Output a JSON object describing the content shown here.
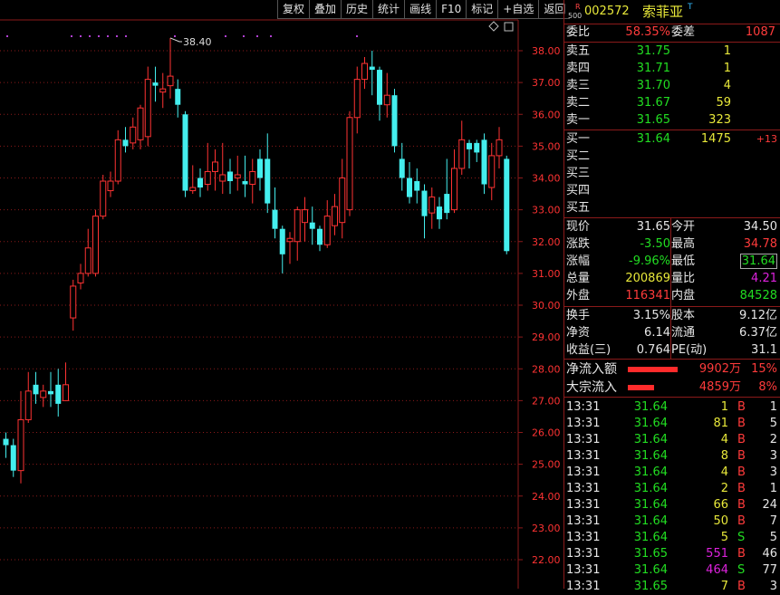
{
  "toolbar": [
    "复权",
    "叠加",
    "历史",
    "统计",
    "画线",
    "F10",
    "标记",
    "+自选",
    "返回"
  ],
  "chart": {
    "price_ticks": [
      "38.00",
      "37.00",
      "36.00",
      "35.00",
      "34.00",
      "33.00",
      "32.00",
      "31.00",
      "30.00",
      "29.00",
      "28.00",
      "27.00",
      "26.00",
      "25.00",
      "24.00",
      "23.00",
      "22.00"
    ],
    "high_label": "38.40",
    "colors": {
      "up": "#ff3333",
      "down": "#44eeee",
      "grid": "#8b1a1a",
      "axis_text": "#ff3333"
    }
  },
  "chart_data": {
    "type": "candlestick",
    "ylim": [
      21.6,
      38.9
    ],
    "candles": [
      {
        "o": 25.8,
        "c": 25.6,
        "h": 26.0,
        "l": 25.2
      },
      {
        "o": 25.6,
        "c": 24.8,
        "h": 25.8,
        "l": 24.6
      },
      {
        "o": 24.8,
        "c": 26.4,
        "h": 27.3,
        "l": 24.4
      },
      {
        "o": 26.4,
        "c": 27.3,
        "h": 27.9,
        "l": 26.3
      },
      {
        "o": 27.5,
        "c": 27.2,
        "h": 27.9,
        "l": 26.9
      },
      {
        "o": 27.1,
        "c": 27.3,
        "h": 27.5,
        "l": 26.8
      },
      {
        "o": 27.3,
        "c": 27.2,
        "h": 27.9,
        "l": 26.8
      },
      {
        "o": 27.5,
        "c": 26.9,
        "h": 28.0,
        "l": 26.5
      },
      {
        "o": 27.0,
        "c": 27.5,
        "h": 28.2,
        "l": 27.0
      },
      {
        "o": 29.6,
        "c": 30.6,
        "h": 30.8,
        "l": 29.2
      },
      {
        "o": 30.7,
        "c": 31.0,
        "h": 31.3,
        "l": 30.5
      },
      {
        "o": 31.0,
        "c": 31.8,
        "h": 32.4,
        "l": 30.9
      },
      {
        "o": 31.0,
        "c": 32.8,
        "h": 33.0,
        "l": 30.9
      },
      {
        "o": 32.8,
        "c": 33.9,
        "h": 34.1,
        "l": 32.7
      },
      {
        "o": 33.6,
        "c": 33.9,
        "h": 34.2,
        "l": 33.4
      },
      {
        "o": 33.9,
        "c": 35.2,
        "h": 35.5,
        "l": 33.8
      },
      {
        "o": 35.2,
        "c": 35.0,
        "h": 35.6,
        "l": 34.8
      },
      {
        "o": 35.1,
        "c": 35.6,
        "h": 35.9,
        "l": 34.9
      },
      {
        "o": 35.2,
        "c": 36.2,
        "h": 36.3,
        "l": 34.9
      },
      {
        "o": 35.3,
        "c": 37.1,
        "h": 37.5,
        "l": 35.0
      },
      {
        "o": 37.0,
        "c": 36.9,
        "h": 37.5,
        "l": 36.4
      },
      {
        "o": 36.7,
        "c": 36.8,
        "h": 37.3,
        "l": 36.2
      },
      {
        "o": 36.9,
        "c": 37.2,
        "h": 38.4,
        "l": 36.5
      },
      {
        "o": 36.8,
        "c": 36.3,
        "h": 37.1,
        "l": 35.9
      },
      {
        "o": 36.0,
        "c": 33.6,
        "h": 36.1,
        "l": 33.4
      },
      {
        "o": 33.6,
        "c": 33.7,
        "h": 34.4,
        "l": 33.5
      },
      {
        "o": 34.0,
        "c": 33.7,
        "h": 34.3,
        "l": 33.4
      },
      {
        "o": 33.8,
        "c": 34.2,
        "h": 35.1,
        "l": 33.6
      },
      {
        "o": 34.2,
        "c": 34.5,
        "h": 34.9,
        "l": 33.6
      },
      {
        "o": 33.9,
        "c": 34.1,
        "h": 35.1,
        "l": 33.5
      },
      {
        "o": 34.2,
        "c": 33.9,
        "h": 34.6,
        "l": 33.5
      },
      {
        "o": 34.0,
        "c": 34.1,
        "h": 34.7,
        "l": 33.6
      },
      {
        "o": 33.9,
        "c": 33.8,
        "h": 34.7,
        "l": 33.4
      },
      {
        "o": 33.8,
        "c": 34.2,
        "h": 34.6,
        "l": 33.2
      },
      {
        "o": 34.6,
        "c": 34.0,
        "h": 34.9,
        "l": 33.6
      },
      {
        "o": 34.6,
        "c": 33.2,
        "h": 35.4,
        "l": 32.9
      },
      {
        "o": 33.0,
        "c": 32.4,
        "h": 33.7,
        "l": 32.1
      },
      {
        "o": 32.4,
        "c": 31.6,
        "h": 32.5,
        "l": 31.0
      },
      {
        "o": 32.0,
        "c": 32.1,
        "h": 32.3,
        "l": 31.3
      },
      {
        "o": 32.0,
        "c": 33.0,
        "h": 33.1,
        "l": 31.4
      },
      {
        "o": 32.6,
        "c": 33.0,
        "h": 33.4,
        "l": 32.0
      },
      {
        "o": 32.6,
        "c": 32.4,
        "h": 33.1,
        "l": 31.9
      },
      {
        "o": 32.4,
        "c": 31.9,
        "h": 32.5,
        "l": 31.7
      },
      {
        "o": 31.9,
        "c": 32.8,
        "h": 33.3,
        "l": 31.8
      },
      {
        "o": 32.5,
        "c": 33.1,
        "h": 33.5,
        "l": 32.2
      },
      {
        "o": 32.6,
        "c": 34.0,
        "h": 34.6,
        "l": 32.1
      },
      {
        "o": 33.0,
        "c": 35.9,
        "h": 36.1,
        "l": 32.8
      },
      {
        "o": 35.9,
        "c": 37.1,
        "h": 37.5,
        "l": 35.4
      },
      {
        "o": 37.1,
        "c": 37.6,
        "h": 37.8,
        "l": 36.8
      },
      {
        "o": 37.5,
        "c": 37.4,
        "h": 38.0,
        "l": 36.6
      },
      {
        "o": 37.4,
        "c": 36.3,
        "h": 37.5,
        "l": 35.8
      },
      {
        "o": 36.3,
        "c": 36.6,
        "h": 37.3,
        "l": 35.9
      },
      {
        "o": 36.6,
        "c": 35.0,
        "h": 36.8,
        "l": 34.8
      },
      {
        "o": 34.6,
        "c": 34.0,
        "h": 35.1,
        "l": 33.6
      },
      {
        "o": 34.0,
        "c": 33.4,
        "h": 34.5,
        "l": 33.2
      },
      {
        "o": 33.9,
        "c": 33.6,
        "h": 34.3,
        "l": 33.2
      },
      {
        "o": 33.6,
        "c": 32.8,
        "h": 33.8,
        "l": 32.1
      },
      {
        "o": 32.9,
        "c": 33.4,
        "h": 33.7,
        "l": 32.4
      },
      {
        "o": 33.1,
        "c": 32.7,
        "h": 33.4,
        "l": 32.4
      },
      {
        "o": 33.5,
        "c": 32.9,
        "h": 34.6,
        "l": 32.7
      },
      {
        "o": 33.0,
        "c": 34.3,
        "h": 34.9,
        "l": 32.9
      },
      {
        "o": 34.3,
        "c": 35.2,
        "h": 35.8,
        "l": 34.1
      },
      {
        "o": 35.1,
        "c": 34.9,
        "h": 35.2,
        "l": 34.3
      },
      {
        "o": 35.1,
        "c": 34.8,
        "h": 35.2,
        "l": 34.5
      },
      {
        "o": 35.2,
        "c": 33.8,
        "h": 35.4,
        "l": 33.5
      },
      {
        "o": 33.7,
        "c": 34.7,
        "h": 35.1,
        "l": 33.3
      },
      {
        "o": 34.7,
        "c": 35.2,
        "h": 35.6,
        "l": 34.3
      },
      {
        "o": 34.6,
        "c": 31.7,
        "h": 34.7,
        "l": 31.6
      }
    ]
  },
  "panel": {
    "badge_top": "R",
    "badge_bottom": "500",
    "code": "002572",
    "name": "索菲亚",
    "flag": "T",
    "ratio": {
      "label": "委比",
      "value": "58.35%",
      "diff_label": "委差",
      "diff_value": "1087"
    },
    "asks": [
      {
        "label": "卖五",
        "price": "31.75",
        "vol": "1"
      },
      {
        "label": "卖四",
        "price": "31.71",
        "vol": "1"
      },
      {
        "label": "卖三",
        "price": "31.70",
        "vol": "4"
      },
      {
        "label": "卖二",
        "price": "31.67",
        "vol": "59"
      },
      {
        "label": "卖一",
        "price": "31.65",
        "vol": "323"
      }
    ],
    "bids": [
      {
        "label": "买一",
        "price": "31.64",
        "vol": "1475",
        "chg": "+13"
      },
      {
        "label": "买二",
        "price": "",
        "vol": "",
        "chg": ""
      },
      {
        "label": "买三",
        "price": "",
        "vol": "",
        "chg": ""
      },
      {
        "label": "买四",
        "price": "",
        "vol": "",
        "chg": ""
      },
      {
        "label": "买五",
        "price": "",
        "vol": "",
        "chg": ""
      }
    ],
    "quote": [
      {
        "l1": "现价",
        "v1": "31.65",
        "l2": "今开",
        "v2": "34.50"
      },
      {
        "l1": "涨跌",
        "v1": "-3.50",
        "l2": "最高",
        "v2": "34.78"
      },
      {
        "l1": "涨幅",
        "v1": "-9.96%",
        "l2": "最低",
        "v2": "31.64"
      },
      {
        "l1": "总量",
        "v1": "200869",
        "l2": "量比",
        "v2": "4.21"
      },
      {
        "l1": "外盘",
        "v1": "116341",
        "l2": "内盘",
        "v2": "84528"
      }
    ],
    "fund": [
      {
        "l1": "换手",
        "v1": "3.15%",
        "l2": "股本",
        "v2": "9.12亿"
      },
      {
        "l1": "净资",
        "v1": "6.14",
        "l2": "流通",
        "v2": "6.37亿"
      },
      {
        "l1": "收益(三)",
        "v1": "0.764",
        "l2": "PE(动)",
        "v2": "31.1"
      }
    ],
    "flow": [
      {
        "label": "净流入额",
        "value": "9902万",
        "pct": "15%",
        "bar_fraction": 0.15
      },
      {
        "label": "大宗流入",
        "value": "4859万",
        "pct": "8%",
        "bar_fraction": 0.08
      }
    ],
    "ticks": [
      {
        "t": "13:31",
        "p": "31.64",
        "v": "1",
        "s": "B",
        "n": "1"
      },
      {
        "t": "13:31",
        "p": "31.64",
        "v": "81",
        "s": "B",
        "n": "5"
      },
      {
        "t": "13:31",
        "p": "31.64",
        "v": "4",
        "s": "B",
        "n": "2"
      },
      {
        "t": "13:31",
        "p": "31.64",
        "v": "8",
        "s": "B",
        "n": "3"
      },
      {
        "t": "13:31",
        "p": "31.64",
        "v": "4",
        "s": "B",
        "n": "3"
      },
      {
        "t": "13:31",
        "p": "31.64",
        "v": "2",
        "s": "B",
        "n": "1"
      },
      {
        "t": "13:31",
        "p": "31.64",
        "v": "66",
        "s": "B",
        "n": "24"
      },
      {
        "t": "13:31",
        "p": "31.64",
        "v": "50",
        "s": "B",
        "n": "7"
      },
      {
        "t": "13:31",
        "p": "31.64",
        "v": "5",
        "s": "S",
        "n": "5"
      },
      {
        "t": "13:31",
        "p": "31.65",
        "v": "551",
        "s": "B",
        "n": "46"
      },
      {
        "t": "13:31",
        "p": "31.64",
        "v": "464",
        "s": "S",
        "n": "77"
      },
      {
        "t": "13:31",
        "p": "31.65",
        "v": "7",
        "s": "B",
        "n": "3"
      }
    ]
  }
}
